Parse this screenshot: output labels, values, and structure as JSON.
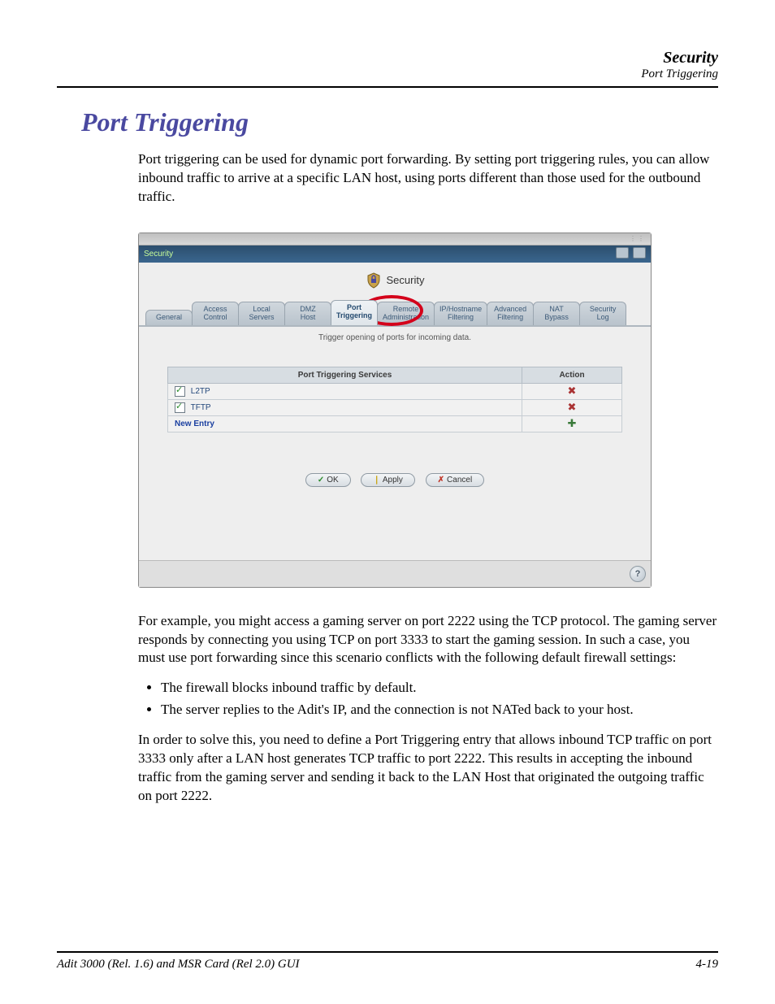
{
  "header": {
    "section": "Security",
    "subsection": "Port Triggering"
  },
  "title": "Port Triggering",
  "intro": "Port triggering can be used for dynamic port forwarding. By setting port triggering rules, you can allow inbound traffic to arrive at a specific LAN host, using ports different than those used for the outbound traffic.",
  "app": {
    "window_title": "Security",
    "panel_title": "Security",
    "tabs": [
      {
        "l1": "General",
        "l2": ""
      },
      {
        "l1": "Access",
        "l2": "Control"
      },
      {
        "l1": "Local",
        "l2": "Servers"
      },
      {
        "l1": "DMZ",
        "l2": "Host"
      },
      {
        "l1": "Port",
        "l2": "Triggering",
        "active": true
      },
      {
        "l1": "Remote",
        "l2": "Administration"
      },
      {
        "l1": "IP/Hostname",
        "l2": "Filtering"
      },
      {
        "l1": "Advanced",
        "l2": "Filtering"
      },
      {
        "l1": "NAT",
        "l2": "Bypass"
      },
      {
        "l1": "Security",
        "l2": "Log"
      }
    ],
    "subcaption": "Trigger opening of ports for incoming data.",
    "table_headers": {
      "services": "Port Triggering Services",
      "action": "Action"
    },
    "rows": [
      {
        "checked": true,
        "label": "L2TP"
      },
      {
        "checked": true,
        "label": "TFTP"
      }
    ],
    "new_entry": "New Entry",
    "buttons": {
      "ok": "OK",
      "apply": "Apply",
      "cancel": "Cancel"
    }
  },
  "example_para": "For example, you might access a gaming server on port 2222 using the TCP protocol. The gaming server responds by connecting you using TCP on port 3333 to start the gaming session. In such a case, you must use port forwarding since this scenario conflicts with the following default firewall settings:",
  "bullets": [
    "The firewall blocks inbound traffic by default.",
    "The server replies to the Adit's IP, and the connection is not NATed back to your host."
  ],
  "solution_para": "In order to solve this, you need to define a Port Triggering entry that allows inbound TCP traffic on port 3333 only after a LAN host generates TCP traffic to port 2222. This results in accepting the inbound traffic from the gaming server and sending it back to the LAN Host that originated the outgoing traffic on port 2222.",
  "footer": {
    "left": "Adit 3000 (Rel. 1.6) and MSR Card (Rel 2.0) GUI",
    "right": "4-19"
  }
}
